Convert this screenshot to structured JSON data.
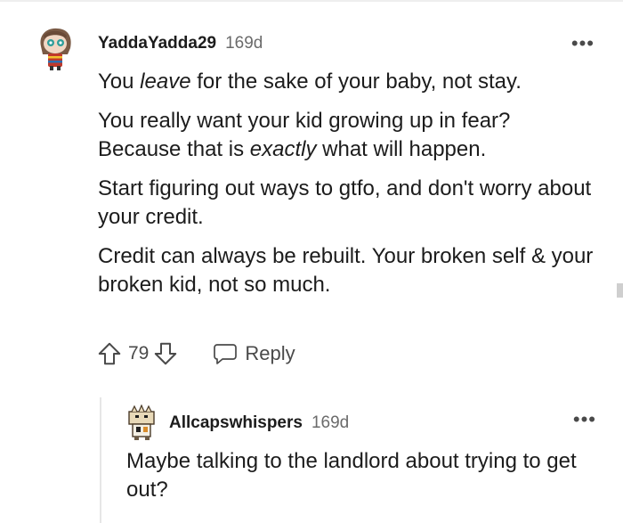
{
  "comment": {
    "username": "YaddaYadda29",
    "age": "169d",
    "paragraphs": [
      {
        "before": "You ",
        "em": "leave",
        "after": " for the sake of your baby, not stay."
      },
      {
        "before": "You really want your kid growing up in fear? Because that is ",
        "em": "exactly",
        "after": " what will happen."
      },
      {
        "before": "Start figuring out ways to gtfo, and don't worry about your credit.",
        "em": "",
        "after": ""
      },
      {
        "before": "Credit can always be rebuilt. Your broken self & your broken kid, not so much.",
        "em": "",
        "after": ""
      }
    ],
    "score": "79",
    "reply_label": "Reply",
    "more_label": "•••",
    "upvote_icon": "arrow-up-outline-icon",
    "downvote_icon": "arrow-down-outline-icon",
    "reply_icon": "speech-bubble-icon"
  },
  "reply": {
    "username": "Allcapswhispers",
    "age": "169d",
    "text": "Maybe talking to the landlord about trying to get out?",
    "more_label": "•••"
  },
  "colors": {
    "text": "#1c1c1c",
    "meta": "#6b6b6b",
    "icon": "#4a4a4a",
    "thread_line": "#e6e6e6"
  }
}
